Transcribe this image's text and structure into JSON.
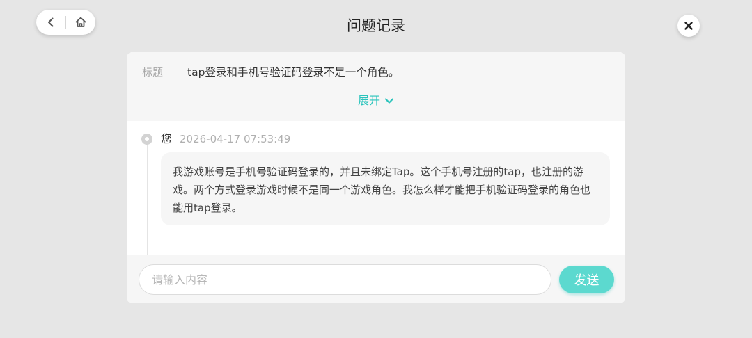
{
  "header": {
    "title": "问题记录",
    "back_icon": "chevron-left-icon",
    "home_icon": "home-icon",
    "close_icon": "close-icon"
  },
  "ticket": {
    "title_label": "标题",
    "title_text": "tap登录和手机号验证码登录不是一个角色。",
    "expand_label": "展开",
    "expand_icon": "chevron-down-icon"
  },
  "messages": [
    {
      "author": "您",
      "timestamp": "2026-04-17 07:53:49",
      "text": "我游戏账号是手机号验证码登录的，并且未绑定Tap。这个手机号注册的tap，也注册的游戏。两个方式登录游戏时候不是同一个游戏角色。我怎么样才能把手机验证码登录的角色也能用tap登录。"
    }
  ],
  "composer": {
    "placeholder": "请输入内容",
    "value": "",
    "send_label": "发送"
  },
  "colors": {
    "accent": "#2bc4bc",
    "send_button": "#5cd9cf",
    "background": "#e6e6e6"
  }
}
